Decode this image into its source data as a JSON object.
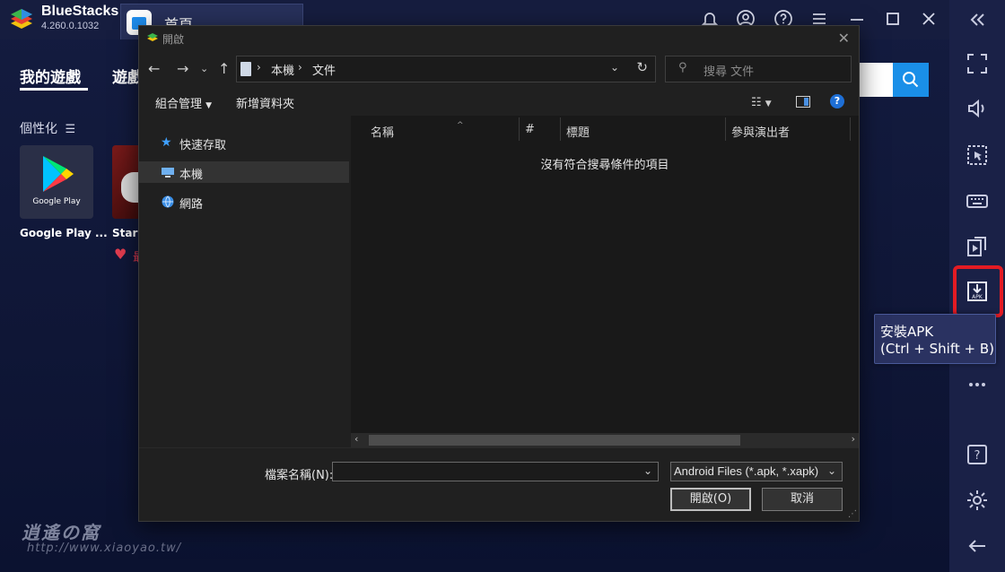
{
  "app": {
    "brand_name": "BlueStacks",
    "version": "4.260.0.1032",
    "home_tab_label": "首頁"
  },
  "main": {
    "tabs": [
      "我的遊戲",
      "遊戲"
    ],
    "section_label": "個性化",
    "google_play_tile_text": "Google Play",
    "apps": [
      {
        "caption": "Google Play ..."
      },
      {
        "caption": "Star T"
      }
    ],
    "heart_text": "最"
  },
  "sidebar": {
    "tooltip_line1": "安裝APK",
    "tooltip_line2": "(Ctrl + Shift + B)",
    "highlight_color": "#e31b23"
  },
  "dialog": {
    "title": "開啟",
    "breadcrumbs": [
      "本機",
      "文件"
    ],
    "search_placeholder": "搜尋 文件",
    "toolbar": {
      "organize": "組合管理",
      "new_folder": "新增資料夾"
    },
    "nav_items": [
      {
        "label": "快速存取",
        "selected": false
      },
      {
        "label": "本機",
        "selected": true
      },
      {
        "label": "網路",
        "selected": false
      }
    ],
    "columns": [
      "名稱",
      "#",
      "標題",
      "參與演出者"
    ],
    "empty_message": "沒有符合搜尋條件的項目",
    "filename_label": "檔案名稱(N):",
    "filename_value": "",
    "file_type": "Android Files (*.apk, *.xapk)",
    "open_button": "開啟(O)",
    "cancel_button": "取消"
  },
  "watermark": {
    "line1": "逍遙の窩",
    "line2": "http://www.xiaoyao.tw/"
  }
}
